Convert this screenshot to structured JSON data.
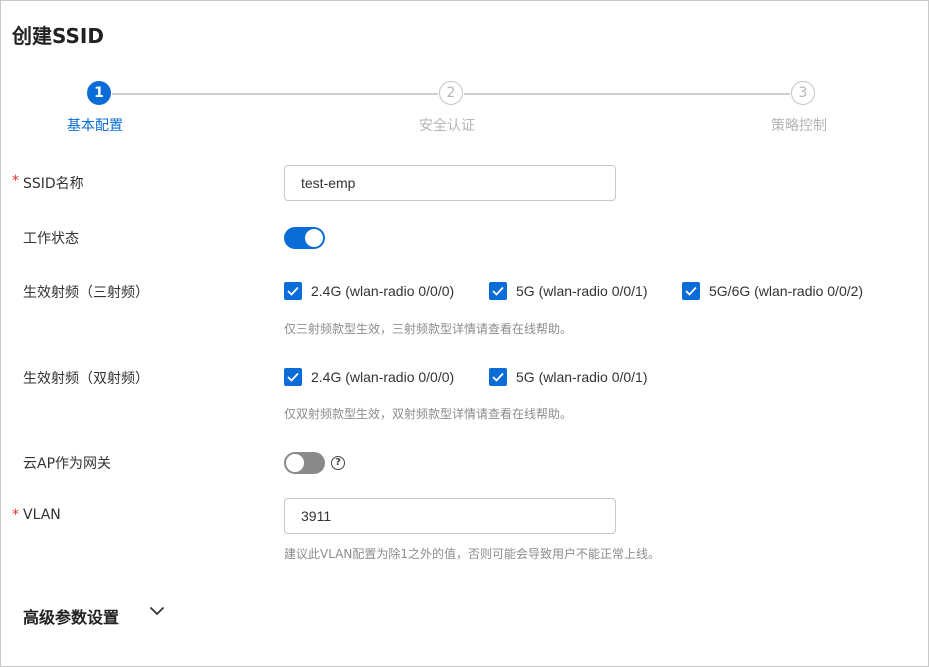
{
  "page": {
    "title": "创建SSID"
  },
  "steps": [
    {
      "number": "1",
      "label": "基本配置",
      "state": "active"
    },
    {
      "number": "2",
      "label": "安全认证",
      "state": "inactive"
    },
    {
      "number": "3",
      "label": "策略控制",
      "state": "inactive"
    }
  ],
  "form": {
    "required_mark": "*",
    "ssid": {
      "label": "SSID名称",
      "value": "test-emp"
    },
    "status": {
      "label": "工作状态",
      "on": true
    },
    "radio_tri": {
      "label": "生效射频（三射频）",
      "options": [
        {
          "label": "2.4G (wlan-radio 0/0/0)",
          "checked": true
        },
        {
          "label": "5G (wlan-radio 0/0/1)",
          "checked": true
        },
        {
          "label": "5G/6G (wlan-radio 0/0/2)",
          "checked": true
        }
      ],
      "hint": "仅三射频款型生效，三射频款型详情请查看在线帮助。"
    },
    "radio_dual": {
      "label": "生效射频（双射频）",
      "options": [
        {
          "label": "2.4G (wlan-radio 0/0/0)",
          "checked": true
        },
        {
          "label": "5G (wlan-radio 0/0/1)",
          "checked": true
        }
      ],
      "hint": "仅双射频款型生效，双射频款型详情请查看在线帮助。"
    },
    "cloud_ap": {
      "label": "云AP作为网关",
      "on": false,
      "help_glyph": "?"
    },
    "vlan": {
      "label": "VLAN",
      "value": "3911",
      "hint": "建议此VLAN配置为除1之外的值，否则可能会导致用户不能正常上线。"
    }
  },
  "advanced": {
    "label": "高级参数设置"
  },
  "colors": {
    "accent": "#0a6cd6",
    "required": "#e0312e",
    "hint": "#8c8c8c"
  }
}
